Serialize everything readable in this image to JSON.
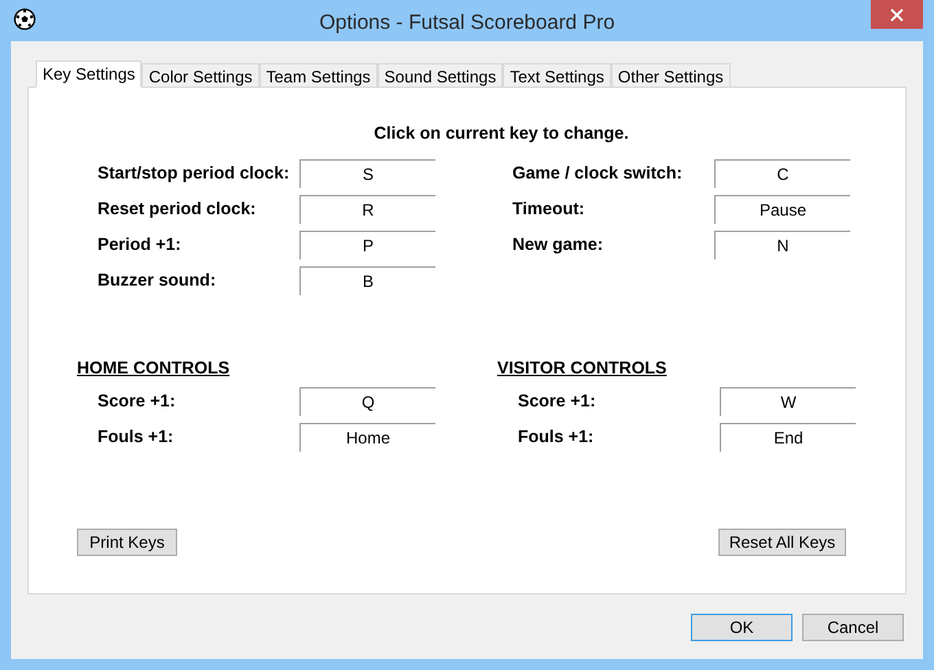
{
  "window": {
    "title": "Options - Futsal Scoreboard Pro"
  },
  "tabs": [
    {
      "label": "Key Settings",
      "selected": true
    },
    {
      "label": "Color Settings",
      "selected": false
    },
    {
      "label": "Team Settings",
      "selected": false
    },
    {
      "label": "Sound Settings",
      "selected": false
    },
    {
      "label": "Text Settings",
      "selected": false
    },
    {
      "label": "Other Settings",
      "selected": false
    }
  ],
  "instruction": "Click on current key to change.",
  "general_keys": {
    "left": [
      {
        "label": "Start/stop period clock:",
        "key": "S"
      },
      {
        "label": "Reset period clock:",
        "key": "R"
      },
      {
        "label": "Period +1:",
        "key": "P"
      },
      {
        "label": "Buzzer sound:",
        "key": "B"
      }
    ],
    "right": [
      {
        "label": "Game / clock switch:",
        "key": "C"
      },
      {
        "label": "Timeout:",
        "key": "Pause"
      },
      {
        "label": "New game:",
        "key": "N"
      }
    ]
  },
  "teams": [
    {
      "heading": "HOME CONTROLS",
      "rows": [
        {
          "label": "Score +1:",
          "key": "Q"
        },
        {
          "label": "Fouls +1:",
          "key": "Home"
        }
      ]
    },
    {
      "heading": "VISITOR CONTROLS",
      "rows": [
        {
          "label": "Score +1:",
          "key": "W"
        },
        {
          "label": "Fouls +1:",
          "key": "End"
        }
      ]
    }
  ],
  "panel_buttons": {
    "print": "Print Keys",
    "reset": "Reset All Keys"
  },
  "dialog_buttons": [
    {
      "label": "OK",
      "default": true
    },
    {
      "label": "Cancel",
      "default": false
    }
  ]
}
